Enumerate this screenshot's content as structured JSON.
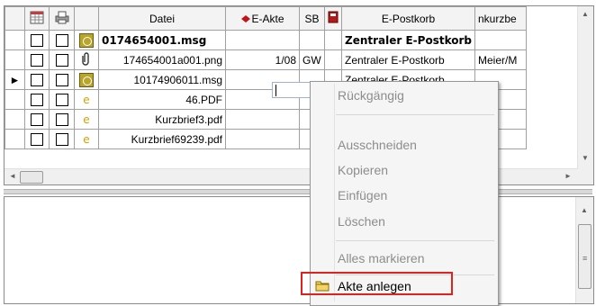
{
  "grid": {
    "columns": [
      "",
      "",
      "",
      "",
      "Datei",
      "E-Akte",
      "SB",
      "",
      "E-Postkorb",
      "nkurzbe"
    ],
    "header_icons": [
      "calendar-grid-icon",
      "printer-icon",
      "red-diamond-icon",
      "red-book-icon"
    ],
    "rows": [
      {
        "indicator": "",
        "icon": "message-icon",
        "datei": "0174654001.msg",
        "eakte": "",
        "sb": "",
        "postkorb": "Zentraler E-Postkorb",
        "extra": "",
        "bold": true
      },
      {
        "indicator": "",
        "icon": "paperclip-icon",
        "datei": "174654001a001.png",
        "eakte": "1/08",
        "sb": "GW",
        "postkorb": "Zentraler E-Postkorb",
        "extra": "Meier/M",
        "bold": false
      },
      {
        "indicator": "►",
        "icon": "message-icon",
        "datei": "10174906011.msg",
        "eakte": "",
        "sb": "",
        "postkorb": "Zentraler E-Postkorb",
        "extra": "",
        "bold": false
      },
      {
        "indicator": "",
        "icon": "pdf-e-icon",
        "datei": "46.PDF",
        "eakte": "",
        "sb": "",
        "postkorb": "",
        "extra": "",
        "bold": false
      },
      {
        "indicator": "",
        "icon": "pdf-e-icon",
        "datei": "Kurzbrief3.pdf",
        "eakte": "",
        "sb": "",
        "postkorb": "",
        "extra": "",
        "bold": false
      },
      {
        "indicator": "",
        "icon": "pdf-e-icon",
        "datei": "Kurzbrief69239.pdf",
        "eakte": "",
        "sb": "",
        "postkorb": "",
        "extra": "",
        "bold": false
      }
    ],
    "pdf_glyph": "e",
    "paperclip_glyph": "🖇"
  },
  "context_menu": {
    "items": [
      "Rückgängig",
      "Ausschneiden",
      "Kopieren",
      "Einfügen",
      "Löschen",
      "Alles markieren",
      "Akte anlegen"
    ],
    "active_item": "Akte anlegen"
  },
  "scroll": {
    "up": "▲",
    "down": "▼",
    "left": "◄",
    "right": "►",
    "grip": "≡"
  },
  "colors": {
    "highlight_border": "#e0221f",
    "menu_disabled_text": "#8d8d8d",
    "msg_icon": "#b8a52a",
    "pdf_icon": "#d5a000"
  }
}
